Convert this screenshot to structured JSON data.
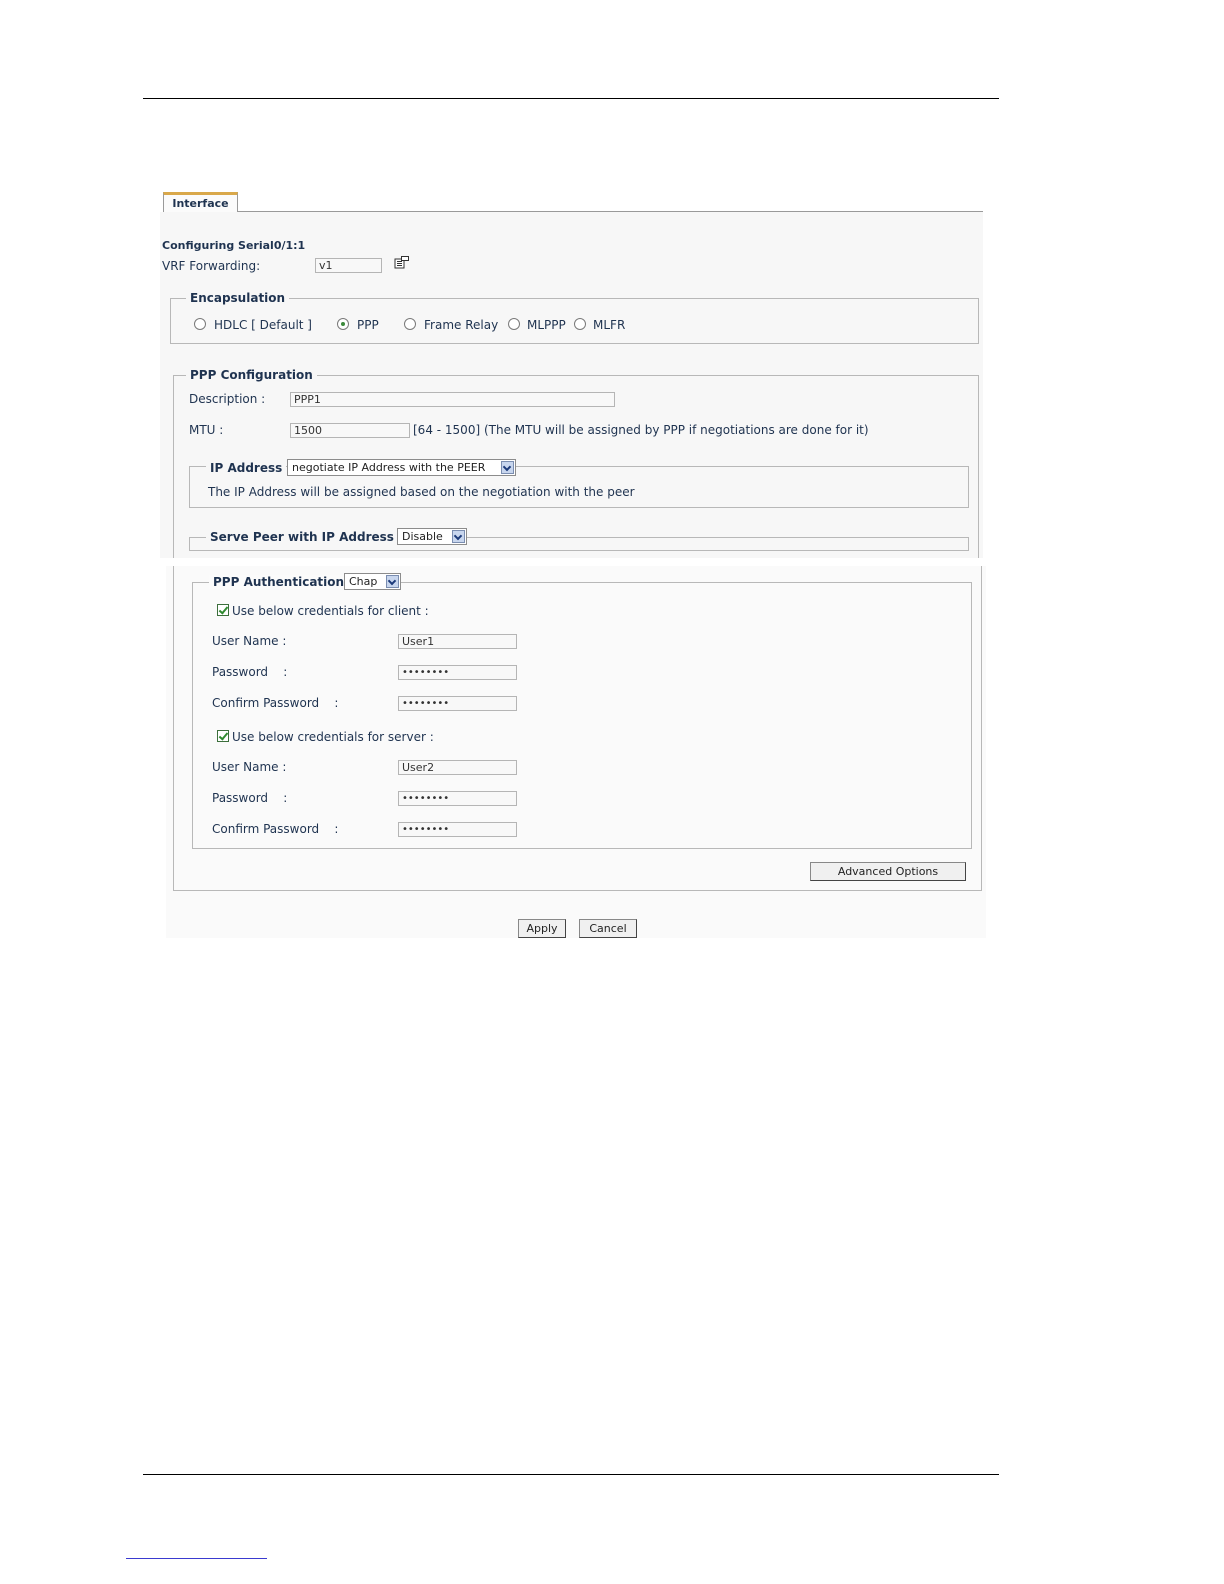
{
  "tab": {
    "label": "Interface"
  },
  "header": {
    "configuring": "Configuring  Serial0/1:1"
  },
  "vrf": {
    "label": "VRF Forwarding:",
    "value": "v1",
    "icon": "properties-icon"
  },
  "encapsulation": {
    "legend": "Encapsulation",
    "options": [
      {
        "label": "HDLC [ Default ]",
        "selected": false
      },
      {
        "label": "PPP",
        "selected": true
      },
      {
        "label": "Frame Relay",
        "selected": false
      },
      {
        "label": "MLPPP",
        "selected": false
      },
      {
        "label": "MLFR",
        "selected": false
      }
    ]
  },
  "ppp": {
    "legend": "PPP Configuration",
    "description_label": "Description :",
    "description_value": "PPP1",
    "mtu_label": "MTU :",
    "mtu_value": "1500",
    "mtu_hint": "[64 - 1500]   (The MTU will be assigned by PPP if negotiations are done for it)"
  },
  "ip_address": {
    "legend": "IP Address",
    "selected": "negotiate IP Address with the PEER",
    "note": "The IP Address will be assigned based on the negotiation with the peer"
  },
  "serve_peer": {
    "legend": "Serve Peer with IP Address",
    "selected": "Disable"
  },
  "auth": {
    "legend": "PPP Authentication",
    "selected": "Chap",
    "client": {
      "checkbox_label": "Use below credentials for client :",
      "checked": true,
      "user_label": "User Name :",
      "user_value": "User1",
      "password_label": "Password    :",
      "password_value": "••••••••",
      "confirm_label": "Confirm Password    :",
      "confirm_value": "••••••••"
    },
    "server": {
      "checkbox_label": "Use below credentials for server :",
      "checked": true,
      "user_label": "User Name :",
      "user_value": "User2",
      "password_label": "Password    :",
      "password_value": "••••••••",
      "confirm_label": "Confirm Password    :",
      "confirm_value": "••••••••"
    }
  },
  "buttons": {
    "advanced": "Advanced Options",
    "apply": "Apply",
    "cancel": "Cancel"
  }
}
